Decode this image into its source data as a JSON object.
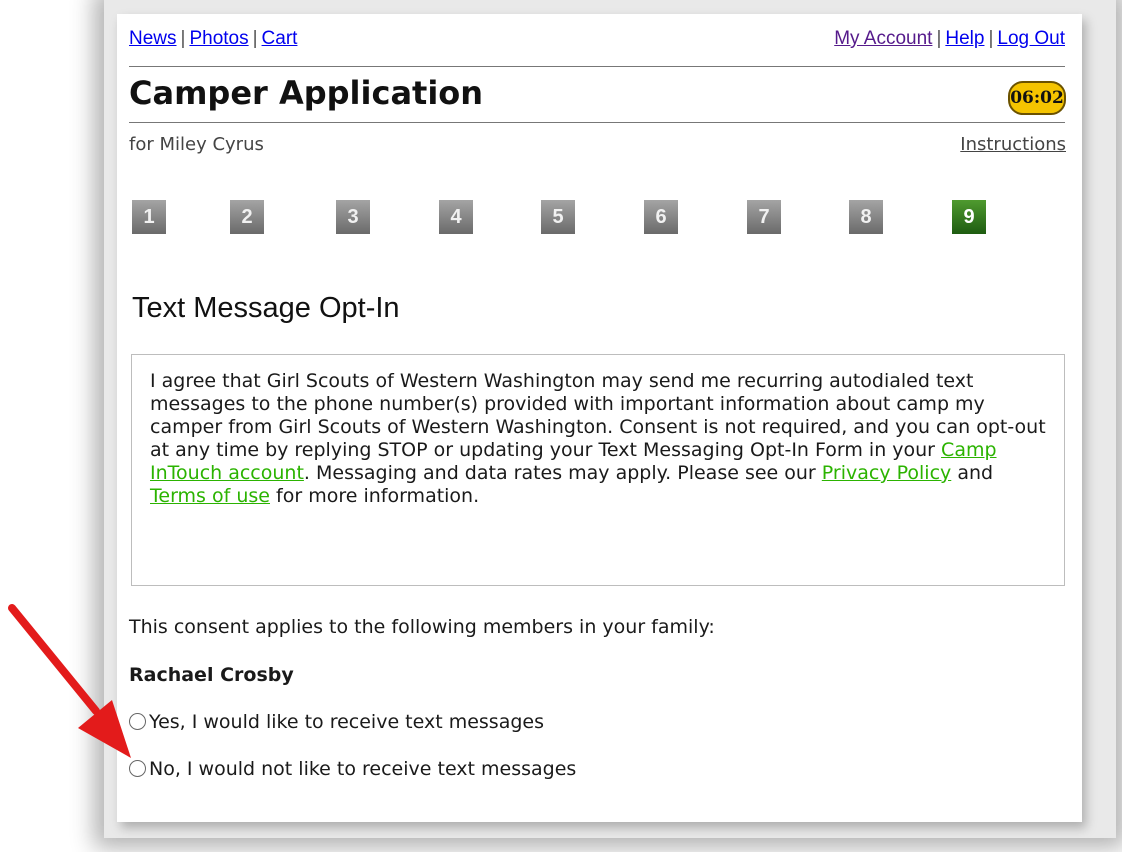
{
  "topnav": {
    "left": [
      "News",
      "Photos",
      "Cart"
    ],
    "right": [
      "My Account",
      "Help",
      "Log Out"
    ],
    "separator": "|"
  },
  "page": {
    "title": "Camper Application",
    "timer": "06:02",
    "subtitle": "for Miley Cyrus",
    "instructions": "Instructions"
  },
  "steps": [
    "1",
    "2",
    "3",
    "4",
    "5",
    "6",
    "7",
    "8",
    "9"
  ],
  "active_step": "9",
  "section": {
    "heading": "Text Message Opt-In",
    "consent_part1": "I agree that Girl Scouts of Western Washington may send me recurring autodialed text messages to the phone number(s) provided with important information about camp my camper from Girl Scouts of Western Washington. Consent is not required, and you can opt-out at any time by replying STOP or updating your Text Messaging Opt-In Form in your ",
    "link_account": "Camp InTouch account",
    "consent_part2": ". Messaging and data rates may apply. Please see our ",
    "link_privacy": "Privacy Policy",
    "consent_part3": " and ",
    "link_terms": "Terms of use",
    "consent_part4": " for more information."
  },
  "family": {
    "applies_text": "This consent applies to the following members in your family:",
    "member_name": "Rachael Crosby",
    "option_yes": "Yes, I would like to receive text messages",
    "option_no": "No, I would not like to receive text messages"
  },
  "colors": {
    "accent_link": "#2bb300",
    "timer_bg": "#f5c400",
    "active_step": "#2e7d1a",
    "arrow": "#e31b1b"
  },
  "icons": {
    "annotation": "red-arrow-icon"
  }
}
